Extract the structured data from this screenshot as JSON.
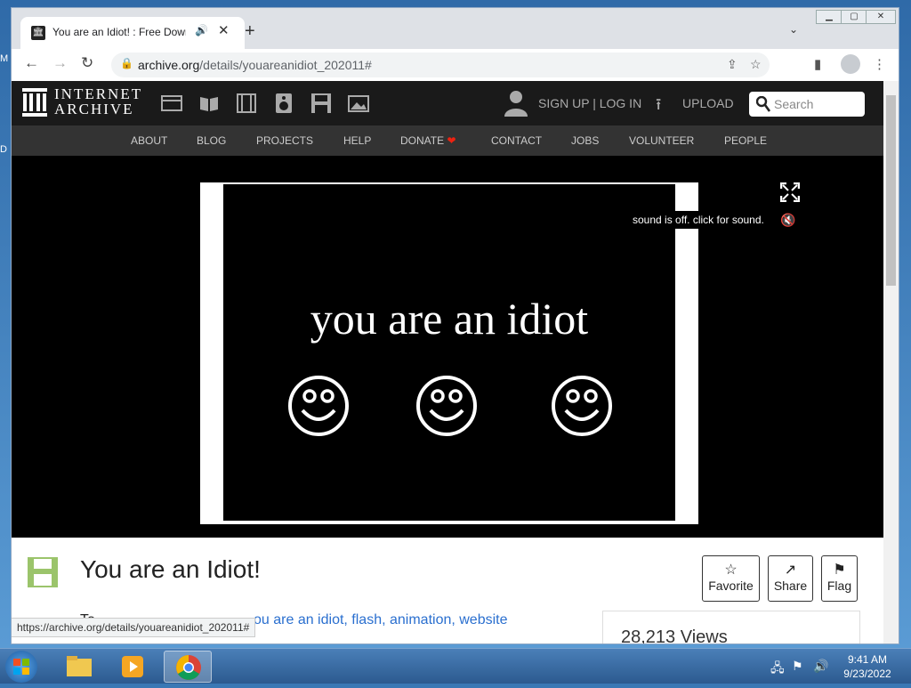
{
  "desktop": {
    "letter_m": "M",
    "letter_d": "D"
  },
  "browser": {
    "tab_title": "You are an Idiot! : Free Down",
    "tab_close": "✕",
    "new_tab": "+",
    "url_host": "archive.org",
    "url_path": "/details/youareanidiot_202011#"
  },
  "ia": {
    "brand_line1": "INTERNET",
    "brand_line2": "ARCHIVE",
    "signup": "SIGN UP | LOG IN",
    "upload": "UPLOAD",
    "search_placeholder": "Search",
    "nav": [
      "ABOUT",
      "BLOG",
      "PROJECTS",
      "HELP",
      "DONATE",
      "CONTACT",
      "JOBS",
      "VOLUNTEER",
      "PEOPLE"
    ]
  },
  "player": {
    "text": "you are an idiot",
    "sound_tip": "sound is off. click for sound."
  },
  "item": {
    "title": "You are an Idiot!",
    "favorite": "Favorite",
    "share": "Share",
    "flag": "Flag",
    "topics_label": "To",
    "topics": "ou are an idiot, flash, animation, website",
    "views": "28,213 Views"
  },
  "status_bar_url": "https://archive.org/details/youareanidiot_202011#",
  "taskbar": {
    "time": "9:41 AM",
    "date": "9/23/2022"
  },
  "colors": {
    "ia_black": "#1a1a1a",
    "ia_nav": "#333333",
    "link_blue": "#2a6fcf",
    "heart": "#ee2211"
  }
}
